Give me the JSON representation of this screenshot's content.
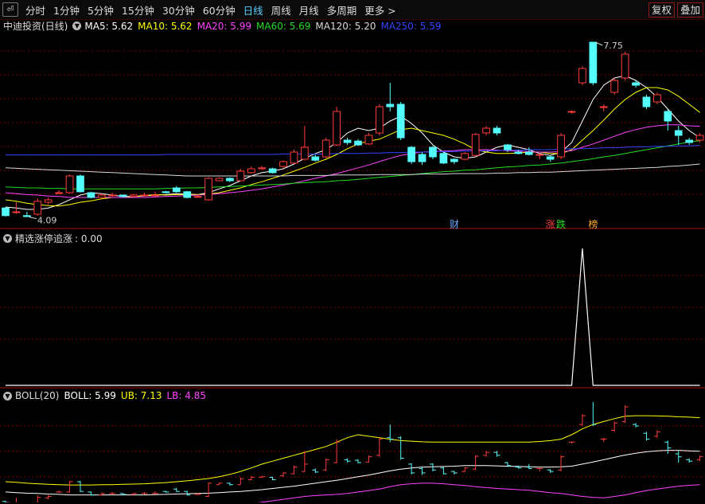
{
  "toolbar": {
    "periods": [
      "分时",
      "1分钟",
      "5分钟",
      "15分钟",
      "30分钟",
      "60分钟",
      "日线",
      "周线",
      "月线",
      "多周期",
      "更多 >"
    ],
    "active_index": 6,
    "right_buttons": [
      "复权",
      "叠加"
    ]
  },
  "main_header": {
    "title": "中迪投资(日线)",
    "indicators": [
      {
        "label": "MA5: 5.62",
        "color": "#ffffff"
      },
      {
        "label": "MA10: 5.62",
        "color": "#ffff00"
      },
      {
        "label": "MA20: 5.99",
        "color": "#ff44ff"
      },
      {
        "label": "MA60: 5.69",
        "color": "#22dd22"
      },
      {
        "label": "MA120: 5.20",
        "color": "#d8d8d8"
      },
      {
        "label": "MA250: 5.59",
        "color": "#3344ff"
      }
    ]
  },
  "markers": {
    "high_label": "7.75",
    "low_label": "4.09",
    "events": [
      {
        "text": "财",
        "index": 42,
        "color": "#66aaff"
      },
      {
        "text": "涨",
        "index": 51,
        "color": "#ff4444"
      },
      {
        "text": "跌",
        "index": 52,
        "color": "#22dd22"
      },
      {
        "text": "榜",
        "index": 55,
        "color": "#ffaa33"
      }
    ]
  },
  "sub1_header": {
    "title": "精选涨停追涨",
    "value": ": 0.00"
  },
  "sub2_header": {
    "title": "BOLL(20)",
    "indicators": [
      {
        "label": "BOLL: 5.99",
        "color": "#ffffff"
      },
      {
        "label": "UB: 7.13",
        "color": "#ffff00"
      },
      {
        "label": "LB: 4.85",
        "color": "#ff44ff"
      }
    ]
  },
  "chart_data": {
    "type": "candlestick",
    "y_range": [
      4.0,
      7.9
    ],
    "candles": [
      [
        4.28,
        4.12,
        4.3,
        4.1
      ],
      [
        4.2,
        4.2,
        4.4,
        4.15
      ],
      [
        4.12,
        4.1,
        4.2,
        4.09
      ],
      [
        4.15,
        4.42,
        4.48,
        4.12
      ],
      [
        4.4,
        4.45,
        4.5,
        4.35
      ],
      [
        4.6,
        4.6,
        4.65,
        4.58
      ],
      [
        4.6,
        4.95,
        4.98,
        4.58
      ],
      [
        4.95,
        4.62,
        4.98,
        4.6
      ],
      [
        4.6,
        4.5,
        4.62,
        4.48
      ],
      [
        4.5,
        4.55,
        4.58,
        4.48
      ],
      [
        4.55,
        4.55,
        4.6,
        4.52
      ],
      [
        4.55,
        4.52,
        4.56,
        4.5
      ],
      [
        4.52,
        4.55,
        4.58,
        4.5
      ],
      [
        4.55,
        4.55,
        4.6,
        4.52
      ],
      [
        4.55,
        4.55,
        4.62,
        4.52
      ],
      [
        4.62,
        4.6,
        4.64,
        4.58
      ],
      [
        4.7,
        4.62,
        4.74,
        4.6
      ],
      [
        4.62,
        4.5,
        4.64,
        4.48
      ],
      [
        4.52,
        4.52,
        4.56,
        4.5
      ],
      [
        4.45,
        4.9,
        4.92,
        4.43
      ],
      [
        4.85,
        4.9,
        4.92,
        4.84
      ],
      [
        4.9,
        4.85,
        4.92,
        4.82
      ],
      [
        4.85,
        5.05,
        5.1,
        4.85
      ],
      [
        5.02,
        5.1,
        5.15,
        5.0
      ],
      [
        5.1,
        5.12,
        5.16,
        5.08
      ],
      [
        5.1,
        5.02,
        5.12,
        5.0
      ],
      [
        5.15,
        5.25,
        5.28,
        5.12
      ],
      [
        5.22,
        5.45,
        5.5,
        5.2
      ],
      [
        5.3,
        5.55,
        6.0,
        5.28
      ],
      [
        5.35,
        5.28,
        5.4,
        5.25
      ],
      [
        5.35,
        5.7,
        5.75,
        5.32
      ],
      [
        5.6,
        6.3,
        6.4,
        5.58
      ],
      [
        5.7,
        5.65,
        5.75,
        5.6
      ],
      [
        5.68,
        5.6,
        5.72,
        5.58
      ],
      [
        5.62,
        5.8,
        5.85,
        5.6
      ],
      [
        5.85,
        6.4,
        6.45,
        5.8
      ],
      [
        6.45,
        6.4,
        6.9,
        6.3
      ],
      [
        6.45,
        5.75,
        6.5,
        5.7
      ],
      [
        5.55,
        5.25,
        5.58,
        5.2
      ],
      [
        5.4,
        5.25,
        5.45,
        5.18
      ],
      [
        5.55,
        5.35,
        5.58,
        5.3
      ],
      [
        5.42,
        5.22,
        5.45,
        5.2
      ],
      [
        5.3,
        5.25,
        5.32,
        5.2
      ],
      [
        5.3,
        5.42,
        5.45,
        5.28
      ],
      [
        5.38,
        5.82,
        5.85,
        5.35
      ],
      [
        5.85,
        5.95,
        6.0,
        5.8
      ],
      [
        5.95,
        5.85,
        6.0,
        5.8
      ],
      [
        5.6,
        5.5,
        5.62,
        5.45
      ],
      [
        5.45,
        5.42,
        5.5,
        5.4
      ],
      [
        5.45,
        5.4,
        5.55,
        5.38
      ],
      [
        5.4,
        5.4,
        5.42,
        5.3
      ],
      [
        5.35,
        5.3,
        5.38,
        5.25
      ],
      [
        5.35,
        5.8,
        5.85,
        5.3
      ],
      [
        6.3,
        6.3,
        6.32,
        6.25
      ],
      [
        6.9,
        7.2,
        7.25,
        6.85
      ],
      [
        7.75,
        6.9,
        7.75,
        6.85
      ],
      [
        6.4,
        6.4,
        6.45,
        6.3
      ],
      [
        6.7,
        6.95,
        7.0,
        6.65
      ],
      [
        7.0,
        7.5,
        7.55,
        6.95
      ],
      [
        6.9,
        6.85,
        6.95,
        6.8
      ],
      [
        6.6,
        6.4,
        6.65,
        6.35
      ],
      [
        6.5,
        6.65,
        6.7,
        6.45
      ],
      [
        6.3,
        6.1,
        6.35,
        5.9
      ],
      [
        5.9,
        5.8,
        6.0,
        5.6
      ],
      [
        5.7,
        5.65,
        5.75,
        5.6
      ],
      [
        5.7,
        5.8,
        5.85,
        5.65
      ]
    ],
    "ma": [
      {
        "name": "MA5",
        "color": "#ffffff",
        "values": [
          4.3,
          4.28,
          4.25,
          4.25,
          4.28,
          4.35,
          4.45,
          4.55,
          4.6,
          4.58,
          4.55,
          4.52,
          4.52,
          4.53,
          4.55,
          4.56,
          4.58,
          4.57,
          4.56,
          4.6,
          4.68,
          4.75,
          4.85,
          4.95,
          5.02,
          5.05,
          5.1,
          5.2,
          5.32,
          5.42,
          5.5,
          5.65,
          5.85,
          5.95,
          5.9,
          5.95,
          6.1,
          6.2,
          6.05,
          5.85,
          5.6,
          5.45,
          5.35,
          5.32,
          5.35,
          5.45,
          5.55,
          5.6,
          5.55,
          5.5,
          5.42,
          5.38,
          5.45,
          5.65,
          6.1,
          6.55,
          6.85,
          7.0,
          7.05,
          6.95,
          6.8,
          6.6,
          6.35,
          6.1,
          5.9,
          5.75
        ]
      },
      {
        "name": "MA10",
        "color": "#ffff00",
        "values": [
          4.45,
          4.42,
          4.38,
          4.35,
          4.33,
          4.32,
          4.35,
          4.4,
          4.43,
          4.47,
          4.5,
          4.5,
          4.52,
          4.54,
          4.56,
          4.55,
          4.56,
          4.56,
          4.56,
          4.57,
          4.6,
          4.65,
          4.7,
          4.77,
          4.83,
          4.9,
          4.97,
          5.05,
          5.13,
          5.22,
          5.3,
          5.4,
          5.52,
          5.62,
          5.68,
          5.72,
          5.82,
          5.92,
          5.95,
          5.9,
          5.85,
          5.8,
          5.72,
          5.62,
          5.5,
          5.45,
          5.42,
          5.42,
          5.43,
          5.45,
          5.45,
          5.42,
          5.42,
          5.5,
          5.7,
          5.9,
          6.12,
          6.35,
          6.55,
          6.7,
          6.8,
          6.8,
          6.75,
          6.62,
          6.45,
          6.28
        ]
      },
      {
        "name": "MA20",
        "color": "#ff44ff",
        "values": [
          4.6,
          4.58,
          4.56,
          4.55,
          4.53,
          4.52,
          4.5,
          4.5,
          4.5,
          4.5,
          4.5,
          4.5,
          4.5,
          4.5,
          4.51,
          4.52,
          4.53,
          4.54,
          4.55,
          4.56,
          4.58,
          4.6,
          4.62,
          4.65,
          4.68,
          4.72,
          4.76,
          4.8,
          4.85,
          4.9,
          4.95,
          5.0,
          5.06,
          5.12,
          5.18,
          5.25,
          5.32,
          5.38,
          5.42,
          5.45,
          5.46,
          5.47,
          5.48,
          5.5,
          5.5,
          5.5,
          5.49,
          5.48,
          5.47,
          5.46,
          5.45,
          5.45,
          5.46,
          5.48,
          5.55,
          5.62,
          5.7,
          5.78,
          5.86,
          5.92,
          5.97,
          6.0,
          6.02,
          6.02,
          6.0,
          5.99
        ]
      },
      {
        "name": "MA60",
        "color": "#22dd22",
        "values": [
          4.72,
          4.71,
          4.7,
          4.7,
          4.69,
          4.69,
          4.68,
          4.68,
          4.68,
          4.68,
          4.68,
          4.68,
          4.68,
          4.68,
          4.68,
          4.69,
          4.69,
          4.7,
          4.7,
          4.71,
          4.72,
          4.73,
          4.74,
          4.75,
          4.76,
          4.77,
          4.78,
          4.8,
          4.81,
          4.82,
          4.83,
          4.85,
          4.86,
          4.88,
          4.9,
          4.92,
          4.94,
          4.96,
          4.98,
          5.0,
          5.02,
          5.04,
          5.05,
          5.07,
          5.08,
          5.1,
          5.12,
          5.14,
          5.15,
          5.17,
          5.18,
          5.2,
          5.22,
          5.25,
          5.28,
          5.31,
          5.35,
          5.38,
          5.42,
          5.46,
          5.5,
          5.54,
          5.58,
          5.62,
          5.66,
          5.69
        ]
      },
      {
        "name": "MA120",
        "color": "#d8d8d8",
        "values": [
          5.12,
          5.11,
          5.1,
          5.09,
          5.08,
          5.07,
          5.06,
          5.05,
          5.04,
          5.03,
          5.02,
          5.01,
          5.0,
          4.99,
          4.98,
          4.97,
          4.96,
          4.95,
          4.95,
          4.95,
          4.95,
          4.95,
          4.95,
          4.95,
          4.95,
          4.95,
          4.95,
          4.96,
          4.96,
          4.96,
          4.96,
          4.97,
          4.97,
          4.97,
          4.97,
          4.98,
          4.98,
          4.98,
          4.98,
          4.99,
          4.99,
          4.99,
          5.0,
          5.0,
          5.0,
          5.0,
          5.01,
          5.01,
          5.02,
          5.02,
          5.03,
          5.03,
          5.04,
          5.05,
          5.06,
          5.07,
          5.08,
          5.09,
          5.1,
          5.11,
          5.12,
          5.13,
          5.15,
          5.16,
          5.18,
          5.2
        ]
      },
      {
        "name": "MA250",
        "color": "#3344ff",
        "values": [
          5.39,
          5.39,
          5.39,
          5.39,
          5.39,
          5.39,
          5.39,
          5.39,
          5.39,
          5.39,
          5.39,
          5.39,
          5.39,
          5.39,
          5.39,
          5.4,
          5.4,
          5.4,
          5.4,
          5.4,
          5.4,
          5.4,
          5.4,
          5.4,
          5.4,
          5.4,
          5.41,
          5.41,
          5.41,
          5.41,
          5.41,
          5.42,
          5.42,
          5.42,
          5.43,
          5.43,
          5.44,
          5.44,
          5.45,
          5.45,
          5.46,
          5.46,
          5.46,
          5.47,
          5.47,
          5.48,
          5.48,
          5.49,
          5.49,
          5.5,
          5.5,
          5.5,
          5.51,
          5.52,
          5.52,
          5.53,
          5.54,
          5.54,
          5.55,
          5.56,
          5.56,
          5.57,
          5.57,
          5.58,
          5.58,
          5.59
        ]
      }
    ],
    "indicator_values": [
      0,
      0,
      0,
      0,
      0,
      0,
      0,
      0,
      0,
      0,
      0,
      0,
      0,
      0,
      0,
      0,
      0,
      0,
      0,
      0,
      0,
      0,
      0,
      0,
      0,
      0,
      0,
      0,
      0,
      0,
      0,
      0,
      0,
      0,
      0,
      0,
      0,
      0,
      0,
      0,
      0,
      0,
      0,
      0,
      0,
      0,
      0,
      0,
      0,
      0,
      0,
      0,
      0,
      0,
      1,
      0,
      0,
      0,
      0,
      0,
      0,
      0,
      0,
      0,
      0,
      0
    ],
    "boll": {
      "range": [
        4.3,
        7.5
      ],
      "mid": [
        4.6,
        4.58,
        4.56,
        4.55,
        4.53,
        4.52,
        4.5,
        4.5,
        4.5,
        4.5,
        4.5,
        4.5,
        4.5,
        4.5,
        4.51,
        4.52,
        4.53,
        4.54,
        4.55,
        4.56,
        4.58,
        4.6,
        4.62,
        4.65,
        4.68,
        4.72,
        4.76,
        4.8,
        4.85,
        4.9,
        4.95,
        5.0,
        5.06,
        5.12,
        5.18,
        5.25,
        5.32,
        5.38,
        5.42,
        5.45,
        5.46,
        5.47,
        5.48,
        5.5,
        5.5,
        5.5,
        5.49,
        5.48,
        5.47,
        5.46,
        5.45,
        5.45,
        5.46,
        5.48,
        5.55,
        5.62,
        5.7,
        5.78,
        5.86,
        5.92,
        5.97,
        6.0,
        6.02,
        6.02,
        6.0,
        5.99
      ],
      "ub": [
        4.95,
        4.93,
        4.9,
        4.88,
        4.86,
        4.85,
        4.84,
        4.84,
        4.84,
        4.85,
        4.85,
        4.86,
        4.87,
        4.88,
        4.9,
        4.92,
        4.95,
        4.98,
        5.02,
        5.06,
        5.12,
        5.2,
        5.3,
        5.42,
        5.55,
        5.65,
        5.75,
        5.85,
        5.95,
        6.05,
        6.15,
        6.3,
        6.45,
        6.55,
        6.5,
        6.45,
        6.4,
        6.35,
        6.33,
        6.31,
        6.3,
        6.3,
        6.3,
        6.3,
        6.3,
        6.3,
        6.3,
        6.3,
        6.3,
        6.3,
        6.32,
        6.35,
        6.4,
        6.55,
        6.75,
        6.9,
        7.0,
        7.1,
        7.18,
        7.2,
        7.2,
        7.19,
        7.18,
        7.16,
        7.15,
        7.13
      ],
      "lb": [
        4.25,
        4.22,
        4.2,
        4.18,
        4.18,
        4.18,
        4.18,
        4.18,
        4.18,
        4.18,
        4.18,
        4.18,
        4.18,
        4.18,
        4.18,
        4.18,
        4.18,
        4.18,
        4.17,
        4.16,
        4.15,
        4.15,
        4.15,
        4.2,
        4.25,
        4.3,
        4.35,
        4.4,
        4.45,
        4.48,
        4.5,
        4.52,
        4.55,
        4.6,
        4.65,
        4.7,
        4.78,
        4.85,
        4.88,
        4.9,
        4.9,
        4.88,
        4.85,
        4.82,
        4.78,
        4.75,
        4.72,
        4.7,
        4.68,
        4.66,
        4.62,
        4.58,
        4.55,
        4.5,
        4.45,
        4.42,
        4.4,
        4.45,
        4.5,
        4.58,
        4.65,
        4.7,
        4.75,
        4.8,
        4.83,
        4.85
      ]
    }
  }
}
